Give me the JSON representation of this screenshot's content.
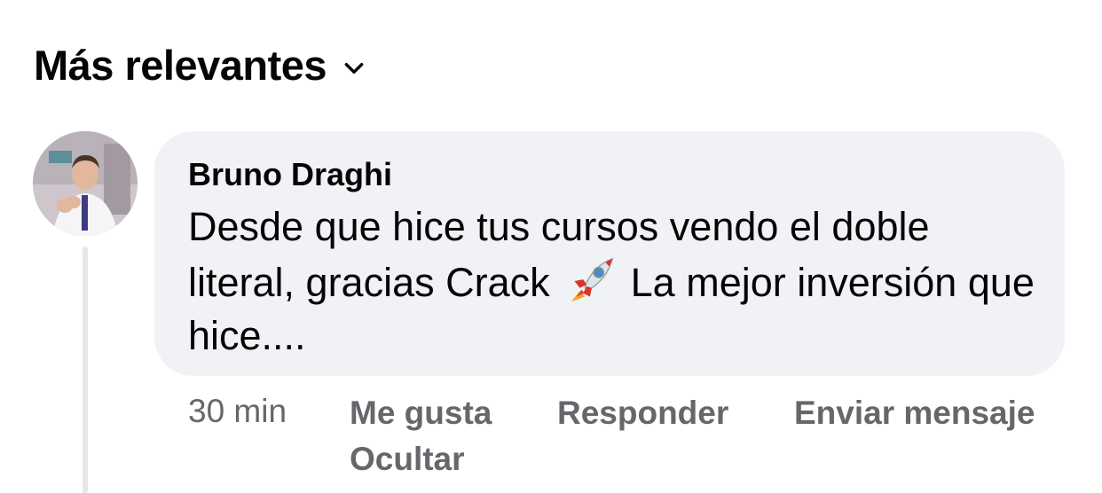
{
  "sort": {
    "label": "Más relevantes",
    "icon": "chevron-down-icon"
  },
  "comment": {
    "author": "Bruno Draghi",
    "text_part1": "Desde que hice tus cursos vendo el doble literal, gracias Crack",
    "emoji": "rocket-emoji-icon",
    "text_part2": "La mejor inversión que hice....",
    "time": "30 min",
    "actions": {
      "like": "Me gusta",
      "reply": "Responder",
      "message": "Enviar mensaje",
      "hide": "Ocultar"
    }
  },
  "colors": {
    "bubble": "#f0f2f5",
    "text": "#050505",
    "secondary": "#65676b",
    "thread_line": "#e4e6eb"
  }
}
